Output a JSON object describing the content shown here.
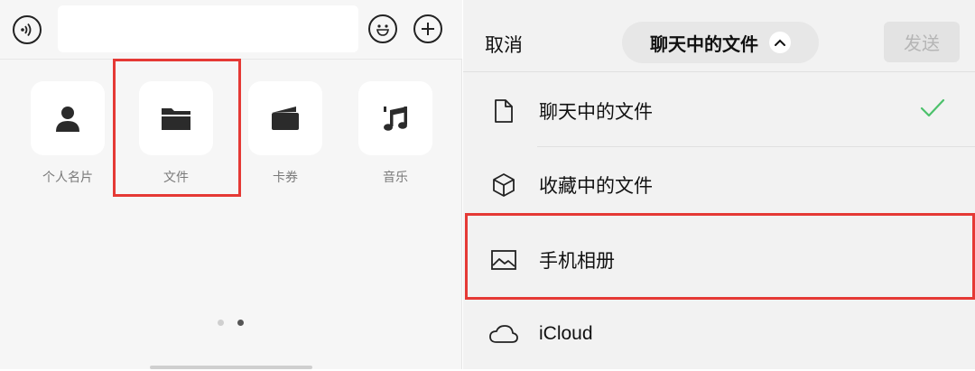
{
  "left_panel": {
    "apps": [
      {
        "label": "个人名片",
        "icon": "person-icon"
      },
      {
        "label": "文件",
        "icon": "folder-icon"
      },
      {
        "label": "卡券",
        "icon": "wallet-icon"
      },
      {
        "label": "音乐",
        "icon": "music-note-icon"
      }
    ],
    "page_dots": {
      "count": 2,
      "active": 2
    }
  },
  "right_panel": {
    "cancel_label": "取消",
    "title": "聊天中的文件",
    "send_label": "发送",
    "options": [
      {
        "label": "聊天中的文件",
        "icon": "document-icon",
        "selected": true
      },
      {
        "label": "收藏中的文件",
        "icon": "cube-icon",
        "selected": false
      },
      {
        "label": "手机相册",
        "icon": "photo-icon",
        "selected": false
      },
      {
        "label": "iCloud",
        "icon": "cloud-icon",
        "selected": false
      }
    ]
  },
  "colors": {
    "highlight": "#e53935",
    "check": "#4cc16b",
    "page_dot_active": "#555555",
    "page_dot_inactive": "#cfcfcf"
  }
}
